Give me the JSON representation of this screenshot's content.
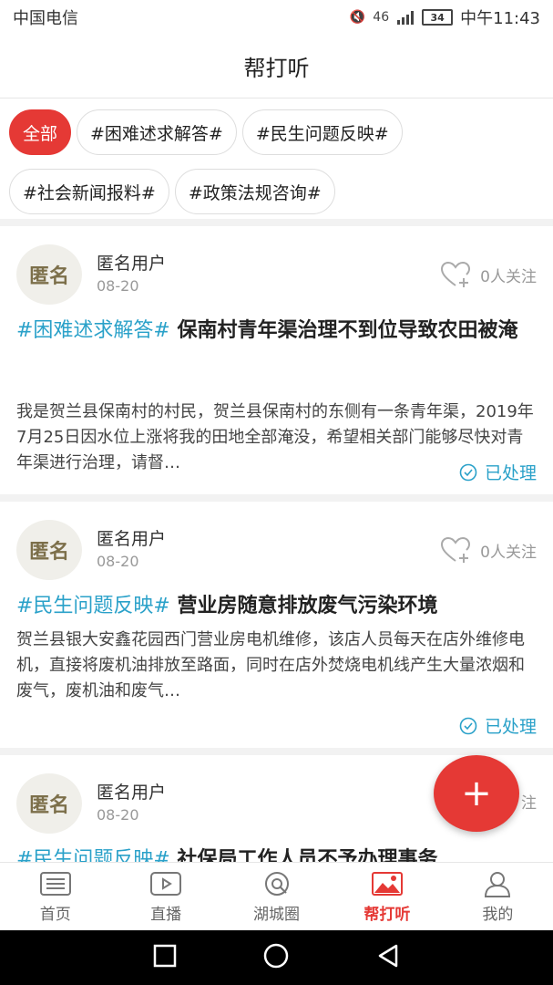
{
  "status_bar": {
    "carrier": "中国电信",
    "network": "46",
    "battery": "34",
    "time": "中午11:43"
  },
  "header": {
    "title": "帮打听"
  },
  "chips": [
    {
      "label": "全部",
      "active": true
    },
    {
      "label": "#困难述求解答#",
      "active": false
    },
    {
      "label": "#民生问题反映#",
      "active": false
    },
    {
      "label": "#社会新闻报料#",
      "active": false
    },
    {
      "label": "#政策法规咨询#",
      "active": false
    }
  ],
  "posts": [
    {
      "avatar_text": "匿名",
      "user": "匿名用户",
      "date": "08-20",
      "follow": "0人关注",
      "tag": "#困难述求解答#",
      "title": "保南村青年渠治理不到位导致农田被淹",
      "body": "我是贺兰县保南村的村民，贺兰县保南村的东侧有一条青年渠，2019年7月25日因水位上涨将我的田地全部淹没，希望相关部门能够尽快对青年渠进行治理，请督…",
      "status": "已处理"
    },
    {
      "avatar_text": "匿名",
      "user": "匿名用户",
      "date": "08-20",
      "follow": "0人关注",
      "tag": "#民生问题反映#",
      "title": "营业房随意排放废气污染环境",
      "body": "贺兰县银大安鑫花园西门营业房电机维修，该店人员每天在店外维修电机，直接将废机油排放至路面，同时在店外焚烧电机线产生大量浓烟和废气，废机油和废气…",
      "status": "已处理"
    },
    {
      "avatar_text": "匿名",
      "user": "匿名用户",
      "date": "08-20",
      "follow_partial": "注",
      "tag": "#民生问题反映#",
      "title": "社保局工作人员不予办理事务"
    }
  ],
  "fab": {
    "label": "+"
  },
  "tabs": [
    {
      "label": "首页",
      "icon": "home-list-icon",
      "active": false
    },
    {
      "label": "直播",
      "icon": "live-tv-icon",
      "active": false
    },
    {
      "label": "湖城圈",
      "icon": "circle-icon",
      "active": false
    },
    {
      "label": "帮打听",
      "icon": "picture-icon",
      "active": true
    },
    {
      "label": "我的",
      "icon": "user-icon",
      "active": false
    }
  ],
  "colors": {
    "accent": "#e53935",
    "tag": "#2aa1c9"
  }
}
